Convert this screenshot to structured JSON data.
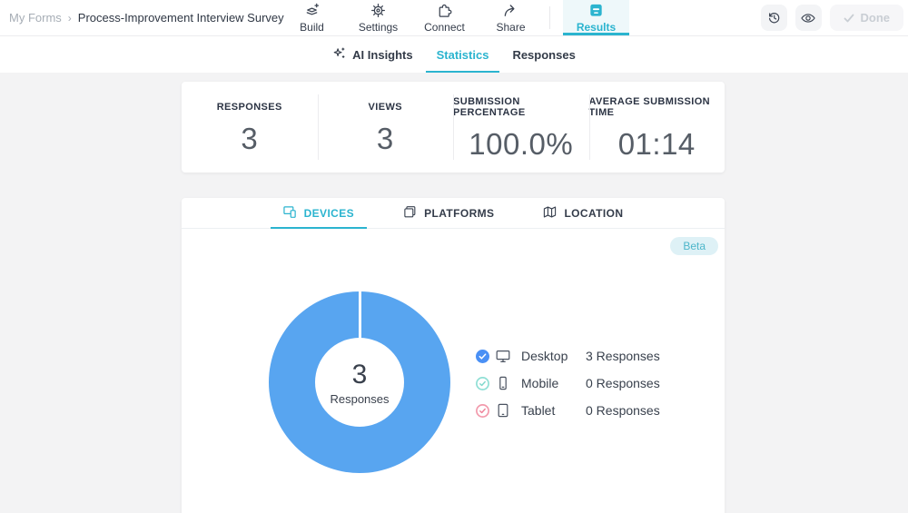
{
  "colors": {
    "accent_teal": "#2bb4cf",
    "donut_blue": "#58a5f0",
    "desktop_marker": "#4a90f5",
    "mobile_marker": "#7fd8cc",
    "tablet_marker": "#ef8ba0",
    "beta_badge_bg": "#def1f6"
  },
  "breadcrumb": {
    "parent": "My Forms",
    "separator": "›",
    "title": "Process-Improvement Interview Survey"
  },
  "topnav": {
    "active": "Results",
    "items": [
      {
        "label": "Build"
      },
      {
        "label": "Settings"
      },
      {
        "label": "Connect"
      },
      {
        "label": "Share"
      },
      {
        "label": "Results"
      }
    ]
  },
  "header_actions": {
    "done_label": "Done"
  },
  "subnav": {
    "active": "Statistics",
    "items": [
      {
        "label": "AI Insights"
      },
      {
        "label": "Statistics"
      },
      {
        "label": "Responses"
      }
    ]
  },
  "stats": [
    {
      "label": "RESPONSES",
      "value": "3"
    },
    {
      "label": "VIEWS",
      "value": "3"
    },
    {
      "label": "SUBMISSION PERCENTAGE",
      "value": "100.0%"
    },
    {
      "label": "AVERAGE SUBMISSION TIME",
      "value": "01:14"
    }
  ],
  "panel": {
    "active_tab": "DEVICES",
    "tabs": [
      {
        "label": "DEVICES"
      },
      {
        "label": "PLATFORMS"
      },
      {
        "label": "LOCATION"
      }
    ],
    "beta_label": "Beta"
  },
  "chart_data": {
    "type": "pie",
    "title": "Devices",
    "categories": [
      "Desktop",
      "Mobile",
      "Tablet"
    ],
    "values": [
      3,
      0,
      0
    ],
    "colors": [
      "#58a5f0",
      "#7fd8cc",
      "#ef8ba0"
    ],
    "center_value": "3",
    "center_label": "Responses",
    "legend_position": "right"
  },
  "legend": [
    {
      "label": "Desktop",
      "count": "3 Responses"
    },
    {
      "label": "Mobile",
      "count": "0 Responses"
    },
    {
      "label": "Tablet",
      "count": "0 Responses"
    }
  ]
}
